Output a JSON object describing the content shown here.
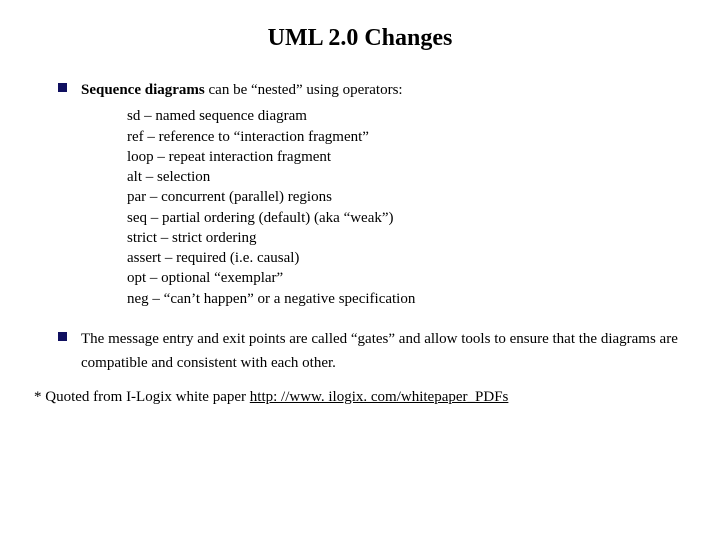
{
  "title": "UML 2.0 Changes",
  "bullet1": {
    "lead_bold": "Sequence diagrams",
    "lead_rest": " can be “nested” using operators:"
  },
  "operators": {
    "i0": "sd – named sequence diagram",
    "i1": "ref – reference to “interaction fragment”",
    "i2": "loop – repeat interaction fragment",
    "i3": "alt – selection",
    "i4": "par – concurrent (parallel) regions",
    "i5": "seq – partial ordering (default) (aka “weak”)",
    "i6": "strict – strict ordering",
    "i7": "assert – required (i.e. causal)",
    "i8": "opt – optional “exemplar”",
    "i9": "neg – “can’t happen” or a negative specification"
  },
  "bullet2": "The message entry and exit points are called “gates” and allow tools to ensure that the diagrams are compatible and consistent with each other.",
  "footnote": {
    "prefix": "* Quoted from I-Logix white paper ",
    "link": "http: //www. ilogix. com/whitepaper_PDFs"
  },
  "colors": {
    "bullet": "#101060"
  }
}
